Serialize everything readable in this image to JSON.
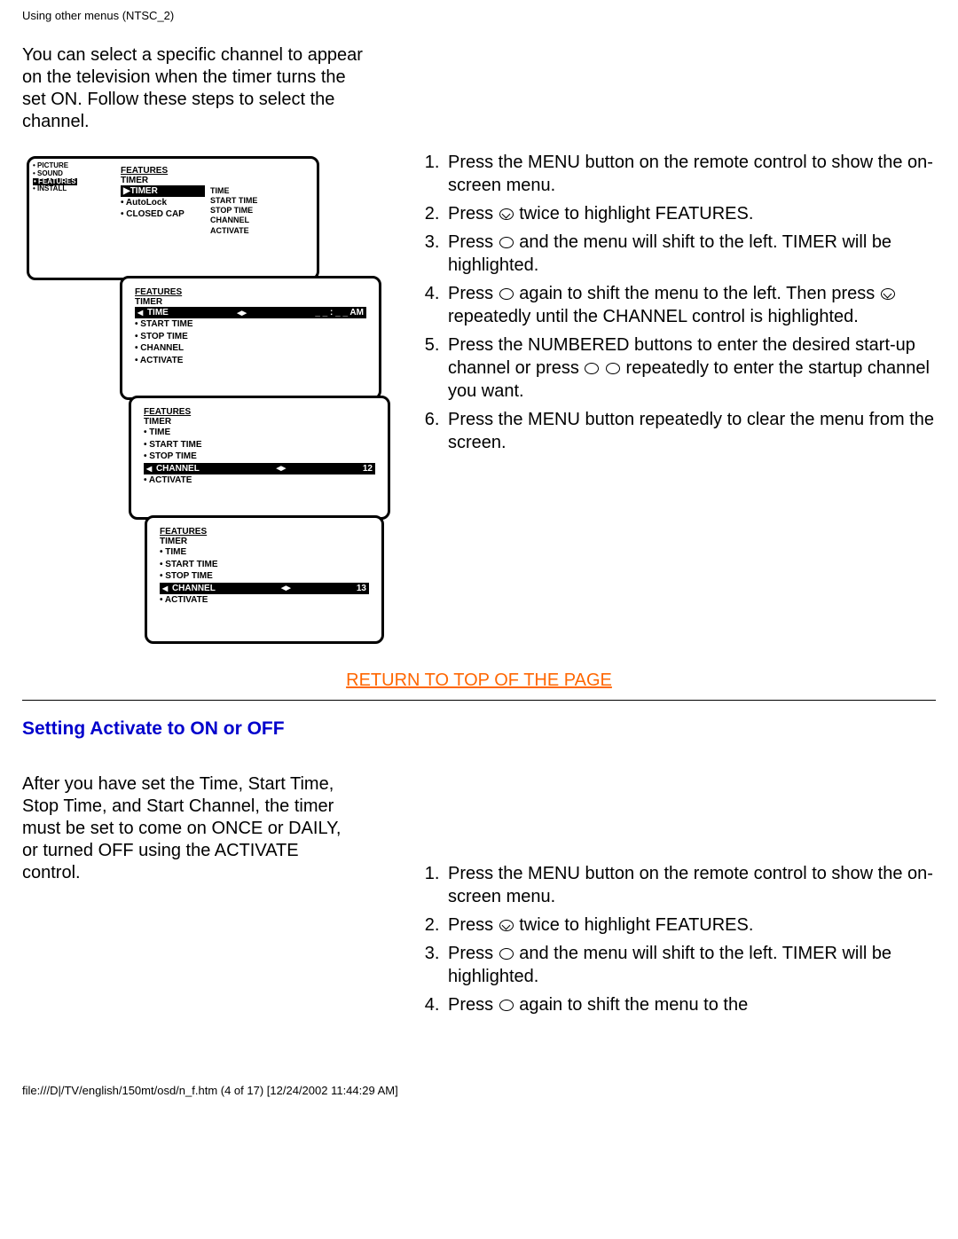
{
  "header": {
    "title": "Using other menus (NTSC_2)"
  },
  "section1": {
    "intro": "You can select a specific channel to appear on the television when the timer turns the set ON. Follow these steps to select the channel.",
    "osd": {
      "box1_sidemenu": [
        "PICTURE",
        "SOUND",
        "FEATURES",
        "INSTALL"
      ],
      "box1_main_heading": "FEATURES",
      "box1_main_sub": "TIMER",
      "box1_main_items_left": [
        "TIMER",
        "AutoLock",
        "CLOSED CAP"
      ],
      "box1_main_items_right": [
        "TIME",
        "START TIME",
        "STOP TIME",
        "CHANNEL",
        "ACTIVATE"
      ],
      "box2_heading": "FEATURES",
      "box2_sub": "TIMER",
      "box2_highlight": "TIME",
      "box2_right": "_ _ : _ _   AM",
      "box2_items": [
        "START TIME",
        "STOP TIME",
        "CHANNEL",
        "ACTIVATE"
      ],
      "box3_heading": "FEATURES",
      "box3_sub": "TIMER",
      "box3_items_before": [
        "TIME",
        "START TIME",
        "STOP TIME"
      ],
      "box3_highlight": "CHANNEL",
      "box3_highlight_value": "12",
      "box3_items_after": [
        "ACTIVATE"
      ],
      "box4_heading": "FEATURES",
      "box4_sub": "TIMER",
      "box4_items_before": [
        "TIME",
        "START TIME",
        "STOP TIME"
      ],
      "box4_highlight": "CHANNEL",
      "box4_highlight_value": "13",
      "box4_items_after": [
        "ACTIVATE"
      ]
    },
    "steps": {
      "s1": "Press the MENU button on the remote control to show the on-screen menu.",
      "s2a": "Press ",
      "s2b": " twice to highlight FEATURES.",
      "s3a": "Press ",
      "s3b": " and the menu will shift to the left. TIMER will be highlighted.",
      "s4a": "Press ",
      "s4b": " again to shift the menu to the left. Then press ",
      "s4c": " repeatedly until the CHANNEL control is highlighted.",
      "s5a": "Press the NUMBERED buttons to enter the desired start-up channel or press ",
      "s5b": " repeatedly to enter the startup channel you want.",
      "s6": "Press the MENU button repeatedly to clear the menu from the screen."
    },
    "return_link": "RETURN TO TOP OF THE PAGE"
  },
  "section2": {
    "heading": "Setting Activate to ON or OFF",
    "intro": "After you have set the Time, Start Time, Stop Time, and Start Channel, the timer must be set to come on ONCE or DAILY, or turned OFF using the ACTIVATE control.",
    "steps": {
      "s1": "Press the MENU button on the remote control to show the on-screen menu.",
      "s2a": "Press ",
      "s2b": " twice to highlight FEATURES.",
      "s3a": "Press ",
      "s3b": " and the menu will shift to the left. TIMER will be highlighted.",
      "s4a": "Press ",
      "s4b": " again to shift the menu to the"
    }
  },
  "footer": {
    "path": "file:///D|/TV/english/150mt/osd/n_f.htm (4 of 17) [12/24/2002 11:44:29 AM]"
  }
}
